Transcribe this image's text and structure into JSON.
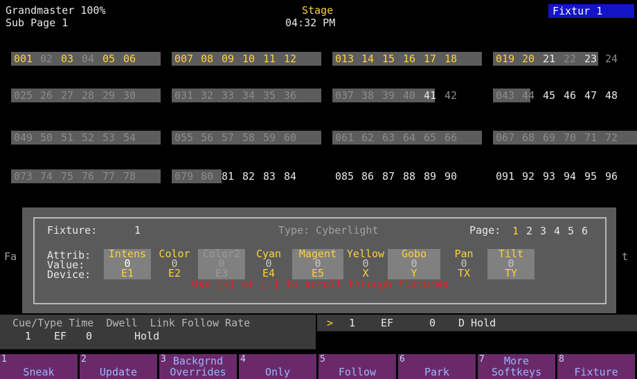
{
  "header": {
    "grandmaster": "Grandmaster 100%",
    "sub_page": "Sub Page 1",
    "mode": "Stage",
    "time": "04:32 PM",
    "display_tag": "Fixtur 1"
  },
  "channel_rows": [
    [
      {
        "t": "001",
        "c": "y"
      },
      {
        "t": "02",
        "c": "g"
      },
      {
        "t": "03",
        "c": "y"
      },
      {
        "t": "04",
        "c": "g"
      },
      {
        "t": "05",
        "c": "y"
      },
      {
        "t": "06",
        "c": "y"
      },
      {
        "t": "007",
        "c": "y"
      },
      {
        "t": "08",
        "c": "y"
      },
      {
        "t": "09",
        "c": "y"
      },
      {
        "t": "10",
        "c": "y"
      },
      {
        "t": "11",
        "c": "y"
      },
      {
        "t": "12",
        "c": "y"
      },
      {
        "t": "013",
        "c": "y"
      },
      {
        "t": "14",
        "c": "y"
      },
      {
        "t": "15",
        "c": "y"
      },
      {
        "t": "16",
        "c": "y"
      },
      {
        "t": "17",
        "c": "y"
      },
      {
        "t": "18",
        "c": "y"
      },
      {
        "t": "019",
        "c": "y"
      },
      {
        "t": "20",
        "c": "y"
      },
      {
        "t": "21",
        "c": "w"
      },
      {
        "t": "22",
        "c": "g"
      },
      {
        "t": "23",
        "c": "w"
      },
      {
        "t": "24",
        "c": "g"
      }
    ],
    [
      {
        "t": "025",
        "c": "g"
      },
      {
        "t": "26",
        "c": "g"
      },
      {
        "t": "27",
        "c": "g"
      },
      {
        "t": "28",
        "c": "g"
      },
      {
        "t": "29",
        "c": "g"
      },
      {
        "t": "30",
        "c": "g"
      },
      {
        "t": "031",
        "c": "g"
      },
      {
        "t": "32",
        "c": "g"
      },
      {
        "t": "33",
        "c": "g"
      },
      {
        "t": "34",
        "c": "g"
      },
      {
        "t": "35",
        "c": "g"
      },
      {
        "t": "36",
        "c": "g"
      },
      {
        "t": "037",
        "c": "g"
      },
      {
        "t": "38",
        "c": "g"
      },
      {
        "t": "39",
        "c": "g"
      },
      {
        "t": "40",
        "c": "g"
      },
      {
        "t": "41",
        "c": "w"
      },
      {
        "t": "42",
        "c": "g"
      },
      {
        "t": "043",
        "c": "g"
      },
      {
        "t": "44",
        "c": "g"
      },
      {
        "t": "45",
        "c": "w"
      },
      {
        "t": "46",
        "c": "w"
      },
      {
        "t": "47",
        "c": "w"
      },
      {
        "t": "48",
        "c": "w"
      }
    ],
    [
      {
        "t": "049",
        "c": "g"
      },
      {
        "t": "50",
        "c": "g"
      },
      {
        "t": "51",
        "c": "g"
      },
      {
        "t": "52",
        "c": "g"
      },
      {
        "t": "53",
        "c": "g"
      },
      {
        "t": "54",
        "c": "g"
      },
      {
        "t": "055",
        "c": "g"
      },
      {
        "t": "56",
        "c": "g"
      },
      {
        "t": "57",
        "c": "g"
      },
      {
        "t": "58",
        "c": "g"
      },
      {
        "t": "59",
        "c": "g"
      },
      {
        "t": "60",
        "c": "g"
      },
      {
        "t": "061",
        "c": "g"
      },
      {
        "t": "62",
        "c": "g"
      },
      {
        "t": "63",
        "c": "g"
      },
      {
        "t": "64",
        "c": "g"
      },
      {
        "t": "65",
        "c": "g"
      },
      {
        "t": "66",
        "c": "g"
      },
      {
        "t": "067",
        "c": "g"
      },
      {
        "t": "68",
        "c": "g"
      },
      {
        "t": "69",
        "c": "g"
      },
      {
        "t": "70",
        "c": "g"
      },
      {
        "t": "71",
        "c": "g"
      },
      {
        "t": "72",
        "c": "g"
      }
    ],
    [
      {
        "t": "073",
        "c": "g"
      },
      {
        "t": "74",
        "c": "g"
      },
      {
        "t": "75",
        "c": "g"
      },
      {
        "t": "76",
        "c": "g"
      },
      {
        "t": "77",
        "c": "g"
      },
      {
        "t": "78",
        "c": "g"
      },
      {
        "t": "079",
        "c": "g"
      },
      {
        "t": "80",
        "c": "g"
      },
      {
        "t": "81",
        "c": "w"
      },
      {
        "t": "82",
        "c": "w"
      },
      {
        "t": "83",
        "c": "w"
      },
      {
        "t": "84",
        "c": "w"
      },
      {
        "t": "085",
        "c": "w"
      },
      {
        "t": "86",
        "c": "w"
      },
      {
        "t": "87",
        "c": "w"
      },
      {
        "t": "88",
        "c": "w"
      },
      {
        "t": "89",
        "c": "w"
      },
      {
        "t": "90",
        "c": "w"
      },
      {
        "t": "091",
        "c": "w"
      },
      {
        "t": "92",
        "c": "w"
      },
      {
        "t": "93",
        "c": "w"
      },
      {
        "t": "94",
        "c": "w"
      },
      {
        "t": "95",
        "c": "w"
      },
      {
        "t": "96",
        "c": "w"
      }
    ]
  ],
  "fixture_panel": {
    "fixture_label": "Fixture:",
    "fixture_number": "1",
    "type_label": "Type: Cyberlight",
    "page_label": "Page:",
    "pages": [
      "1",
      "2",
      "3",
      "4",
      "5",
      "6"
    ],
    "row_labels": [
      "Attrib:",
      "Value:",
      "Device:"
    ],
    "attributes": [
      {
        "name": "Intens",
        "value": "0",
        "device": "E1"
      },
      {
        "name": "Color",
        "value": "0",
        "device": "E2"
      },
      {
        "name": "Color2",
        "value": "0",
        "device": "E3"
      },
      {
        "name": "Cyan",
        "value": "0",
        "device": "E4"
      },
      {
        "name": "Magent",
        "value": "0",
        "device": "E5"
      },
      {
        "name": "Yellow",
        "value": "0",
        "device": "X"
      },
      {
        "name": "Gobo",
        "value": "0",
        "device": "Y"
      },
      {
        "name": "Pan",
        "value": "0",
        "device": "TX"
      },
      {
        "name": "Tilt",
        "value": "0",
        "device": "TY"
      }
    ],
    "message": "Use [+] or [-] to scroll through fixtures",
    "left_edge_text": "Fa",
    "right_edge_text": "t"
  },
  "cue": {
    "headers": "Cue/Type Time  Dwell  Link Follow Rate",
    "cue_number": "1",
    "cue_type": "EF",
    "cue_time": "0",
    "cue_dwell": "Hold",
    "arrow": ">",
    "r_cue": "1",
    "r_type": "EF",
    "r_time": "0",
    "r_dwell": "D Hold"
  },
  "softkeys": [
    {
      "n": "1",
      "l1": "",
      "l2": "Sneak"
    },
    {
      "n": "2",
      "l1": "",
      "l2": "Update"
    },
    {
      "n": "3",
      "l1": "Backgrnd",
      "l2": "Overrides"
    },
    {
      "n": "4",
      "l1": "",
      "l2": "Only"
    },
    {
      "n": "5",
      "l1": "",
      "l2": "Follow"
    },
    {
      "n": "6",
      "l1": "",
      "l2": "Park"
    },
    {
      "n": "7",
      "l1": "More",
      "l2": "Softkeys"
    },
    {
      "n": "8",
      "l1": "",
      "l2": "Fixture"
    }
  ],
  "colors": {
    "yellow": "#ffd23a",
    "red": "#e62020",
    "softkey_bg": "#6a2a6a",
    "softkey_text": "#9fb4ff",
    "tag_blue": "#1414c8"
  }
}
